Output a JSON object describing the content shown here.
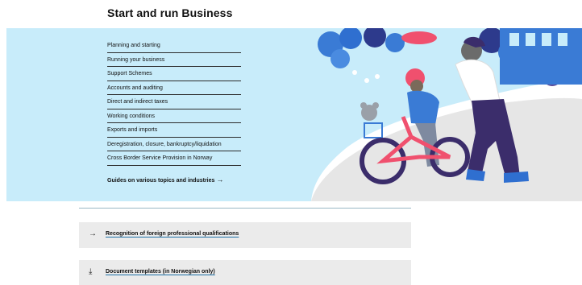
{
  "page": {
    "title": "Start and run Business"
  },
  "topics": [
    "Planning and starting",
    "Running your business",
    "Support Schemes",
    "Accounts and auditing",
    "Direct and indirect taxes",
    "Working conditions",
    "Exports and imports",
    "Deregistration, closure, bankruptcy/liquidation",
    "Cross Border Service Provision in Norway"
  ],
  "guides": {
    "label": "Guides on various topics and industries",
    "arrow": "→"
  },
  "panels": [
    {
      "label": "Recognition of foreign professional qualifications",
      "icon": "→",
      "icon_name": "arrow-right-icon"
    },
    {
      "label": "Document templates (in Norwegian only)",
      "icon": "⤓",
      "icon_name": "download-icon"
    }
  ],
  "colors": {
    "hero_bg": "#c8ecfa",
    "accent_link": "#1d6fa5",
    "panel_bg": "#ebebeb",
    "bike_red": "#f0506e",
    "navy": "#3b2d6b"
  },
  "illustration": {
    "subject": "adult teaching child to ride a bicycle with a teddy bear in basket"
  }
}
